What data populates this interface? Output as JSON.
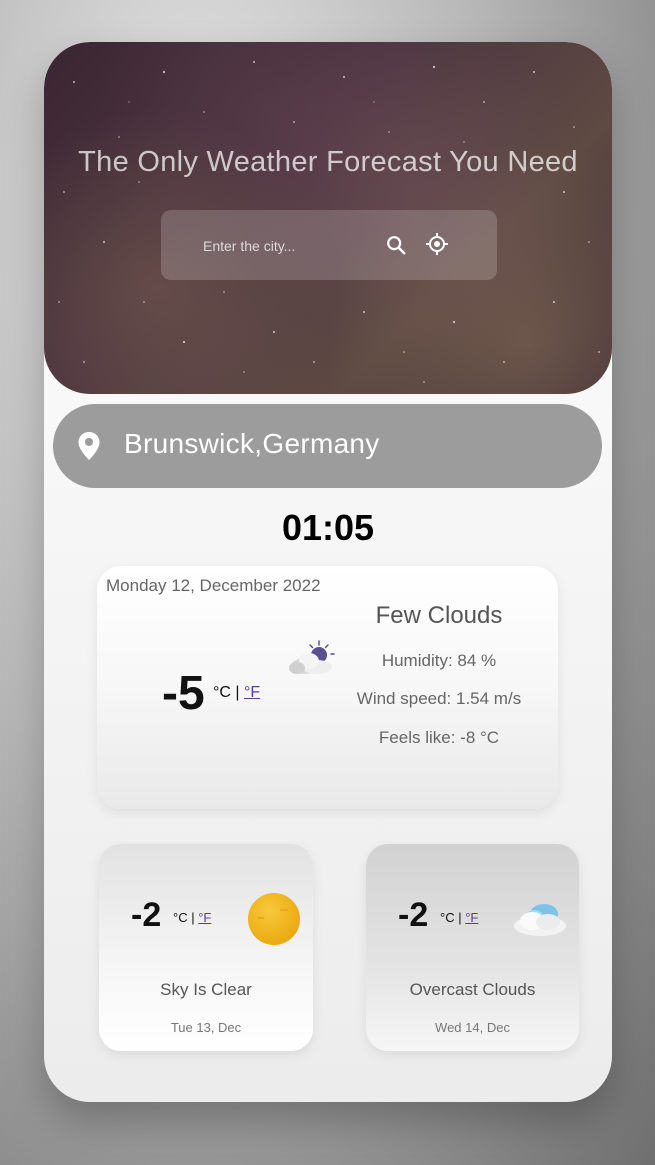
{
  "header": {
    "title": "The Only Weather Forecast You Need",
    "search_placeholder": "Enter the city..."
  },
  "location": {
    "text": "Brunswick,Germany"
  },
  "clock": "01:05",
  "today": {
    "date": "Monday 12, December 2022",
    "temperature": "-5",
    "unit_c": "°C",
    "separator": "|",
    "unit_f": "°F",
    "description": "Few Clouds",
    "humidity": "Humidity: 84 %",
    "wind": "Wind speed: 1.54 m/s",
    "feels_like": "Feels like: -8 °C",
    "icon": "few-clouds-night-icon"
  },
  "forecast": [
    {
      "temperature": "-2",
      "unit_c": "°C",
      "separator": "|",
      "unit_f": "°F",
      "description": "Sky Is Clear",
      "date": "Tue 13, Dec",
      "icon": "sun-icon"
    },
    {
      "temperature": "-2",
      "unit_c": "°C",
      "separator": "|",
      "unit_f": "°F",
      "description": "Overcast Clouds",
      "date": "Wed 14, Dec",
      "icon": "cloud-icon"
    }
  ],
  "colors": {
    "location_bar": "#9c9c9c",
    "link": "#5b3f8f",
    "sun": "#f2b818"
  }
}
